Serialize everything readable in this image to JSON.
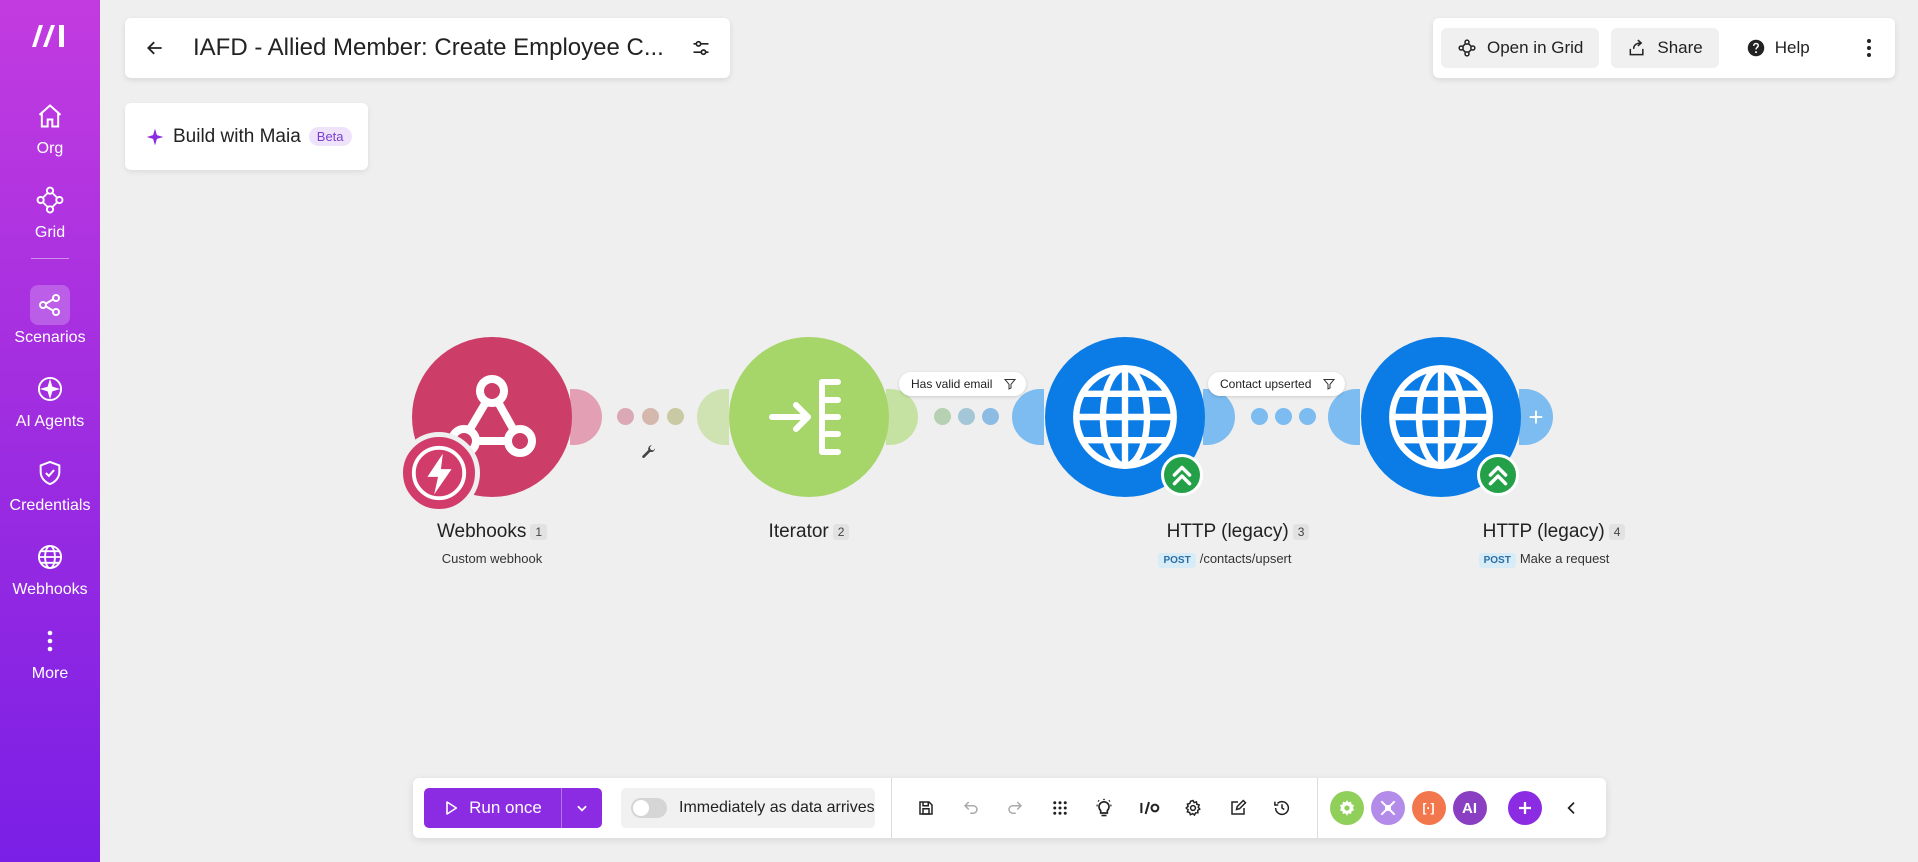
{
  "sidebar": {
    "logo_icon": "make-logo-icon",
    "items": [
      {
        "label": "Org",
        "icon": "home-icon"
      },
      {
        "label": "Grid",
        "icon": "grid-icon"
      },
      {
        "label": "Scenarios",
        "icon": "scenarios-icon",
        "active": true
      },
      {
        "label": "AI Agents",
        "icon": "ai-agents-icon"
      },
      {
        "label": "Credentials",
        "icon": "shield-check-icon"
      },
      {
        "label": "Webhooks",
        "icon": "globe-icon"
      },
      {
        "label": "More",
        "icon": "more-vertical-icon"
      }
    ]
  },
  "header": {
    "title": "IAFD - Allied Member: Create Employee C...",
    "maia_label": "Build with Maia",
    "maia_badge": "Beta"
  },
  "top_toolbar": {
    "open_in_grid": "Open in Grid",
    "share": "Share",
    "help": "Help"
  },
  "scenario": {
    "modules": [
      {
        "title": "Webhooks",
        "index": "1",
        "subtitle": "Custom webhook",
        "color": "#cc3d68"
      },
      {
        "title": "Iterator",
        "index": "2",
        "subtitle": "",
        "color": "#a6d56a"
      },
      {
        "title": "HTTP (legacy)",
        "index": "3",
        "method": "POST",
        "subtitle": "/contacts/upsert",
        "color": "#0b7ce6"
      },
      {
        "title": "HTTP (legacy)",
        "index": "4",
        "method": "POST",
        "subtitle": "Make a request",
        "color": "#0b7ce6"
      }
    ],
    "filters": [
      {
        "label": "Has valid email"
      },
      {
        "label": "Contact upserted"
      }
    ]
  },
  "bottom_toolbar": {
    "run_once": "Run once",
    "schedule_label": "Immediately as data arrives",
    "schedule_enabled": false,
    "tools": [
      "save-icon",
      "undo-icon",
      "redo-icon",
      "auto-align-icon",
      "explain-flow-icon",
      "io-icon",
      "settings-icon",
      "notes-icon",
      "history-icon"
    ],
    "apps": [
      {
        "label": "",
        "color": "#8fcf5a",
        "icon": "tools-gear-icon"
      },
      {
        "label": "",
        "color": "#b38be8",
        "icon": "flow-control-icon"
      },
      {
        "label": "[·]",
        "color": "#f2774c",
        "icon": "json-icon"
      },
      {
        "label": "AI",
        "color": "#8a3ec2",
        "icon": "ai-app-icon"
      }
    ]
  },
  "colors": {
    "accent": "#8b2be2",
    "sidebar_top": "#c23be0",
    "sidebar_bottom": "#7a1fe6",
    "webhook": "#cc3d68",
    "iterator": "#a6d56a",
    "http": "#0b7ce6"
  }
}
